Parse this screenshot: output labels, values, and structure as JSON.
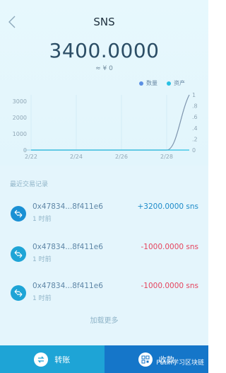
{
  "header": {
    "title": "SNS",
    "back_icon": "chevron-left-icon"
  },
  "balance": {
    "amount": "3400.0000",
    "fiat": "≈ ¥ 0"
  },
  "chart_data": {
    "type": "line",
    "title": "",
    "x_ticks": [
      "2/22",
      "2/24",
      "2/26",
      "2/28"
    ],
    "y_left_ticks": [
      "0",
      "1000",
      "2000",
      "3000"
    ],
    "y_right_ticks": [
      "0",
      ".2",
      ".4",
      ".6",
      ".8",
      "1"
    ],
    "y_left_range": [
      0,
      3400
    ],
    "y_right_range": [
      0,
      1
    ],
    "grid": true,
    "legend_position": "top-right",
    "series": [
      {
        "name": "数量",
        "color": "#5b8fe3",
        "axis": "left",
        "x": [
          "2/22",
          "2/23",
          "2/24",
          "2/25",
          "2/26",
          "2/27",
          "2/28",
          "3/1"
        ],
        "values": [
          0,
          0,
          0,
          0,
          0,
          0,
          0,
          3400
        ]
      },
      {
        "name": "资产",
        "color": "#29c0e3",
        "axis": "right",
        "x": [
          "2/22",
          "2/23",
          "2/24",
          "2/25",
          "2/26",
          "2/27",
          "2/28",
          "3/1"
        ],
        "values": [
          0,
          0,
          0,
          0,
          0,
          0,
          0,
          0
        ]
      }
    ]
  },
  "transactions": {
    "section_title": "最近交易记录",
    "items": [
      {
        "address": "0x47834...8f411e6",
        "time": "1 时前",
        "amount": "+3200.0000 sns",
        "direction": "in"
      },
      {
        "address": "0x47834...8f411e6",
        "time": "1 时前",
        "amount": "-1000.0000 sns",
        "direction": "out"
      },
      {
        "address": "0x47834...8f411e6",
        "time": "1 时前",
        "amount": "-1000.0000 sns",
        "direction": "out"
      }
    ],
    "load_more": "加载更多"
  },
  "footer": {
    "transfer_label": "转账",
    "receive_label": "收款",
    "transfer_icon": "transfer-icon",
    "receive_icon": "qr-code-icon"
  },
  "watermark": "Putin学习区块链",
  "colors": {
    "accent": "#1ea4d6",
    "accent_dark": "#1576c9",
    "positive": "#1d8bc9",
    "negative": "#e5445e"
  }
}
